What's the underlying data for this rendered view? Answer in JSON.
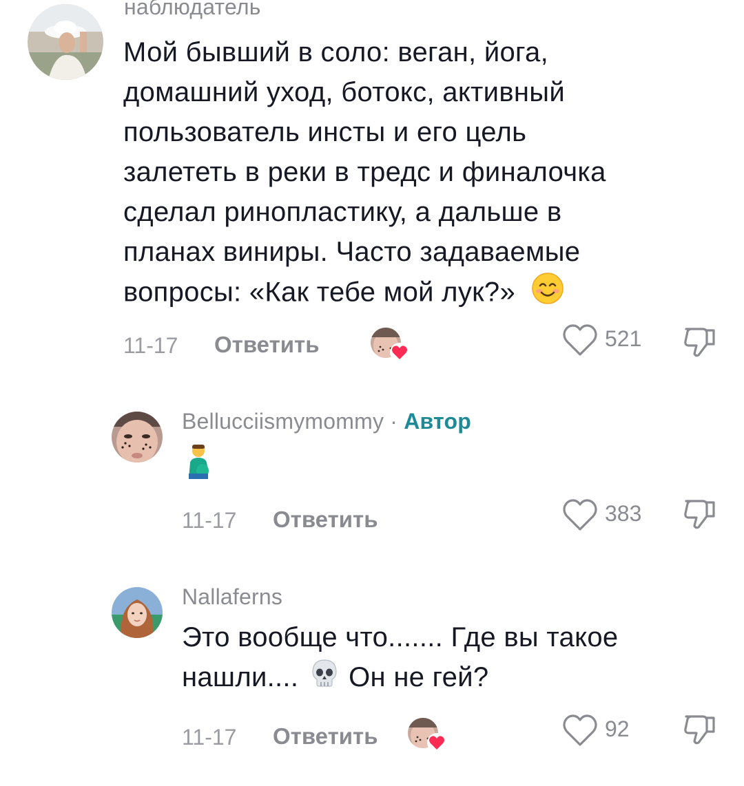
{
  "comments": [
    {
      "username": "наблюдатель",
      "text_lines": [
        "Мой бывший в соло: веган, йога,",
        "домашний уход, ботокс, активный",
        "пользователь инсты и его цель",
        "залететь в реки в тредс и финалочка",
        "сделал ринопластику, а дальше в",
        "планах виниры. Часто задаваемые",
        "вопросы: «Как тебе мой лук?»"
      ],
      "date": "11-17",
      "reply_label": "Ответить",
      "likes": "521",
      "liked_by_creator": true
    },
    {
      "username": "Bellucciismymommy",
      "separator": " · ",
      "author_badge": "Автор",
      "text": "",
      "date": "11-17",
      "reply_label": "Ответить",
      "likes": "383",
      "liked_by_creator": false
    },
    {
      "username": "Nallaferns",
      "text_line1": "Это вообще что....... Где вы такое",
      "text_line2a": "нашли....",
      "text_line2b": " Он не гей?",
      "date": "11-17",
      "reply_label": "Ответить",
      "likes": "92",
      "liked_by_creator": true
    }
  ],
  "icons": {
    "like": "heart-outline-icon",
    "dislike": "thumbs-down-icon",
    "emoji_smile": "smiling-face-icon",
    "emoji_pregnant_man": "pregnant-man-icon",
    "emoji_skull": "skull-icon",
    "liked_heart": "red-heart-badge-icon"
  },
  "colors": {
    "text": "#161823",
    "secondary": "#8a8b91",
    "author_badge": "#1f8a96",
    "heart_badge": "#fe2c55"
  }
}
